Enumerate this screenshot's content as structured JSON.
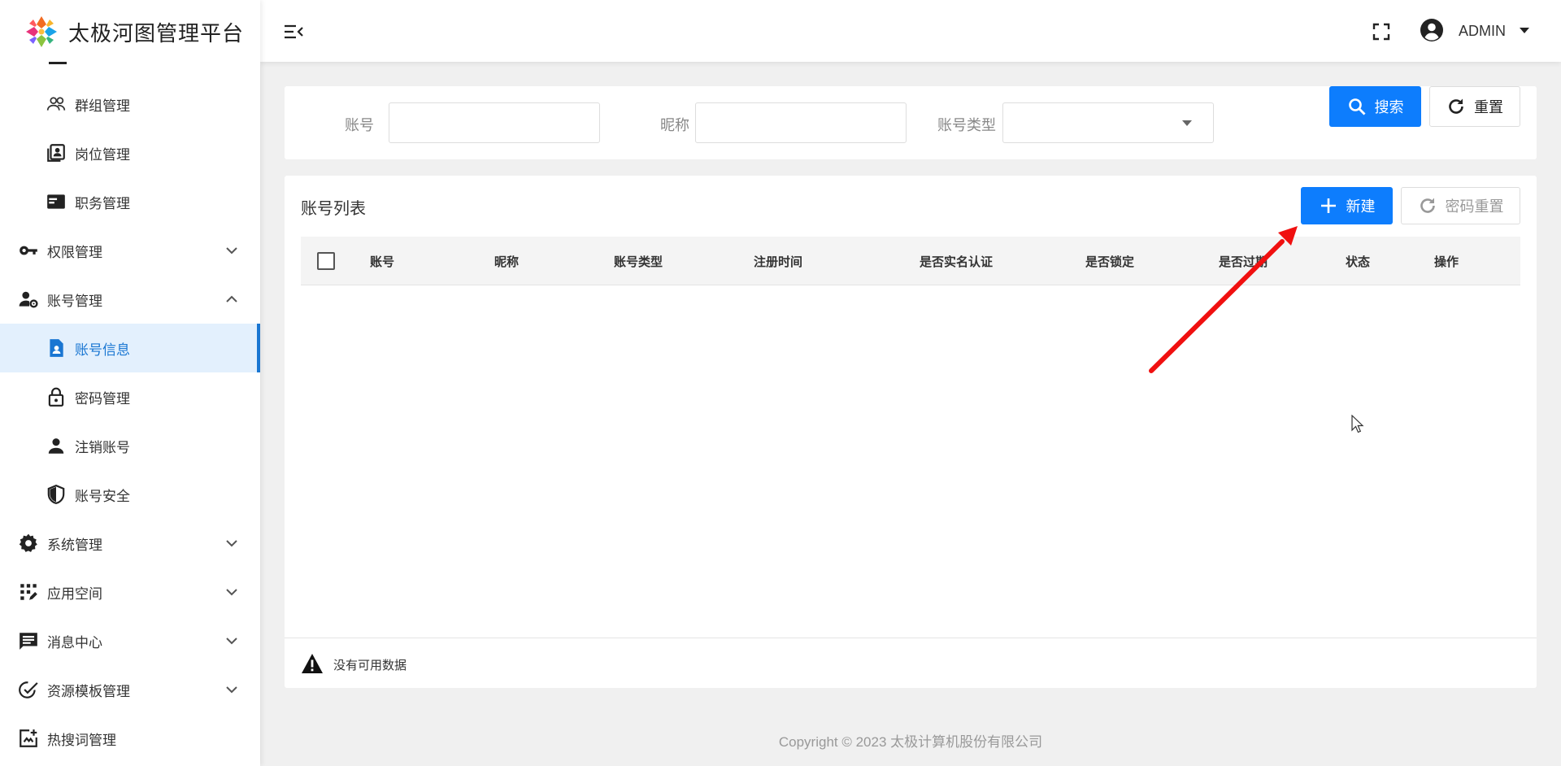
{
  "app": {
    "title": "太极河图管理平台"
  },
  "sidebar": {
    "items": [
      {
        "label": "群组管理",
        "icon": "group-icon",
        "level": "sub"
      },
      {
        "label": "岗位管理",
        "icon": "badge-icon",
        "level": "sub"
      },
      {
        "label": "职务管理",
        "icon": "card-icon",
        "level": "sub"
      },
      {
        "label": "权限管理",
        "icon": "key-icon",
        "level": "top",
        "expandable": true,
        "expanded": false
      },
      {
        "label": "账号管理",
        "icon": "user-settings-icon",
        "level": "top",
        "expandable": true,
        "expanded": true
      },
      {
        "label": "账号信息",
        "icon": "account-info-icon",
        "level": "sub",
        "active": true
      },
      {
        "label": "密码管理",
        "icon": "lock-icon",
        "level": "sub"
      },
      {
        "label": "注销账号",
        "icon": "person-icon",
        "level": "sub"
      },
      {
        "label": "账号安全",
        "icon": "shield-icon",
        "level": "sub"
      },
      {
        "label": "系统管理",
        "icon": "gear-icon",
        "level": "top",
        "expandable": true,
        "expanded": false
      },
      {
        "label": "应用空间",
        "icon": "apps-icon",
        "level": "top",
        "expandable": true,
        "expanded": false
      },
      {
        "label": "消息中心",
        "icon": "message-icon",
        "level": "top",
        "expandable": true,
        "expanded": false
      },
      {
        "label": "资源模板管理",
        "icon": "template-check-icon",
        "level": "top",
        "expandable": true,
        "expanded": false
      },
      {
        "label": "热搜词管理",
        "icon": "hot-search-icon",
        "level": "top",
        "expandable": false
      }
    ]
  },
  "header": {
    "username": "ADMIN"
  },
  "search": {
    "account_label": "账号",
    "account_value": "",
    "nickname_label": "昵称",
    "nickname_value": "",
    "type_label": "账号类型",
    "type_value": "",
    "search_button": "搜索",
    "reset_button": "重置"
  },
  "table": {
    "title": "账号列表",
    "new_button": "新建",
    "reset_password_button": "密码重置",
    "columns": [
      "账号",
      "昵称",
      "账号类型",
      "注册时间",
      "是否实名认证",
      "是否锁定",
      "是否过期",
      "状态",
      "操作"
    ],
    "rows": [],
    "empty_text": "没有可用数据"
  },
  "footer": {
    "copyright": "Copyright © 2023 太极计算机股份有限公司"
  },
  "colors": {
    "primary": "#0d7dfd",
    "active_bg": "#e3f0fd",
    "active_text": "#1976d2",
    "annotation": "#f01010"
  }
}
